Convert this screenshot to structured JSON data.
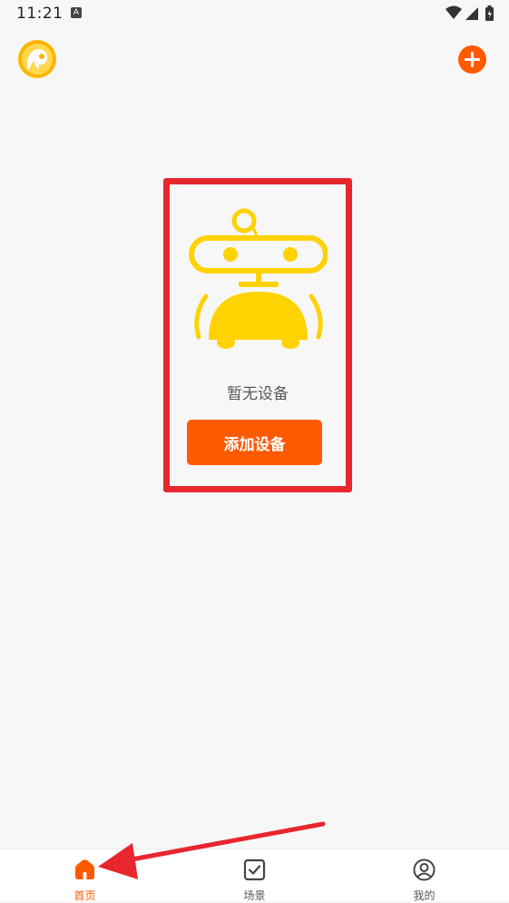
{
  "status_bar": {
    "time": "11:21",
    "notification_icon": "a-letter-icon",
    "right_icons": [
      "wifi-icon",
      "signal-icon",
      "battery-icon"
    ]
  },
  "header": {
    "logo_icon": "app-logo-icon",
    "add_icon": "plus-circle-icon"
  },
  "empty_state": {
    "illustration": "robot-illustration",
    "message": "暂无设备",
    "button_label": "添加设备"
  },
  "bottom_nav": {
    "items": [
      {
        "label": "首页",
        "icon": "home-icon",
        "active": true
      },
      {
        "label": "场景",
        "icon": "checkbox-icon",
        "active": false
      },
      {
        "label": "我的",
        "icon": "profile-icon",
        "active": false
      }
    ]
  },
  "colors": {
    "accent": "#ff5a00",
    "robot_yellow": "#ffd200",
    "highlight_red": "#e8262e",
    "background": "#f7f7f7"
  }
}
